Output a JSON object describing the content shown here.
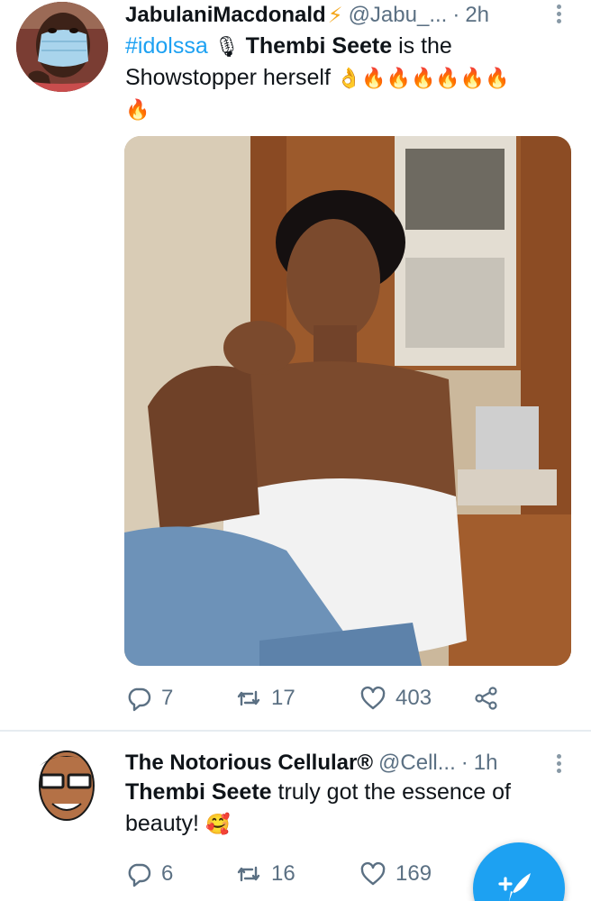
{
  "tweets": [
    {
      "author_name": "JabulaniMacdonald",
      "name_icon": "lightning-bolt-icon",
      "handle": "@Jabu_...",
      "separator": "·",
      "time": "2h",
      "text": {
        "hashtag": "#idolssa",
        "hashtag_emoji": "🎙",
        "mention_bold": "Thembi  Seete",
        "rest_line1": " is the",
        "rest_line2": "Showstopper herself",
        "emojis": "👌🔥🔥🔥🔥🔥🔥",
        "emojis_line3": "🔥"
      },
      "media": "photo-woman-white-top-kitchen",
      "actions": {
        "reply_count": "7",
        "retweet_count": "17",
        "like_count": "403"
      }
    },
    {
      "author_name": "The Notorious Cellular®",
      "handle": "@Cell...",
      "separator": "·",
      "time": "1h",
      "text": {
        "mention_bold": "Thembi Seete",
        "rest_line1": " truly got the essence of",
        "rest_line2": "beauty!",
        "emoji": "🥰"
      },
      "actions": {
        "reply_count": "6",
        "retweet_count": "16",
        "like_count": "169"
      }
    }
  ],
  "colors": {
    "accent": "#1da1f2",
    "muted": "#5b7083",
    "text": "#0f1419",
    "bolt": "#f4a71d"
  },
  "fab_icon": "compose-tweet-icon"
}
